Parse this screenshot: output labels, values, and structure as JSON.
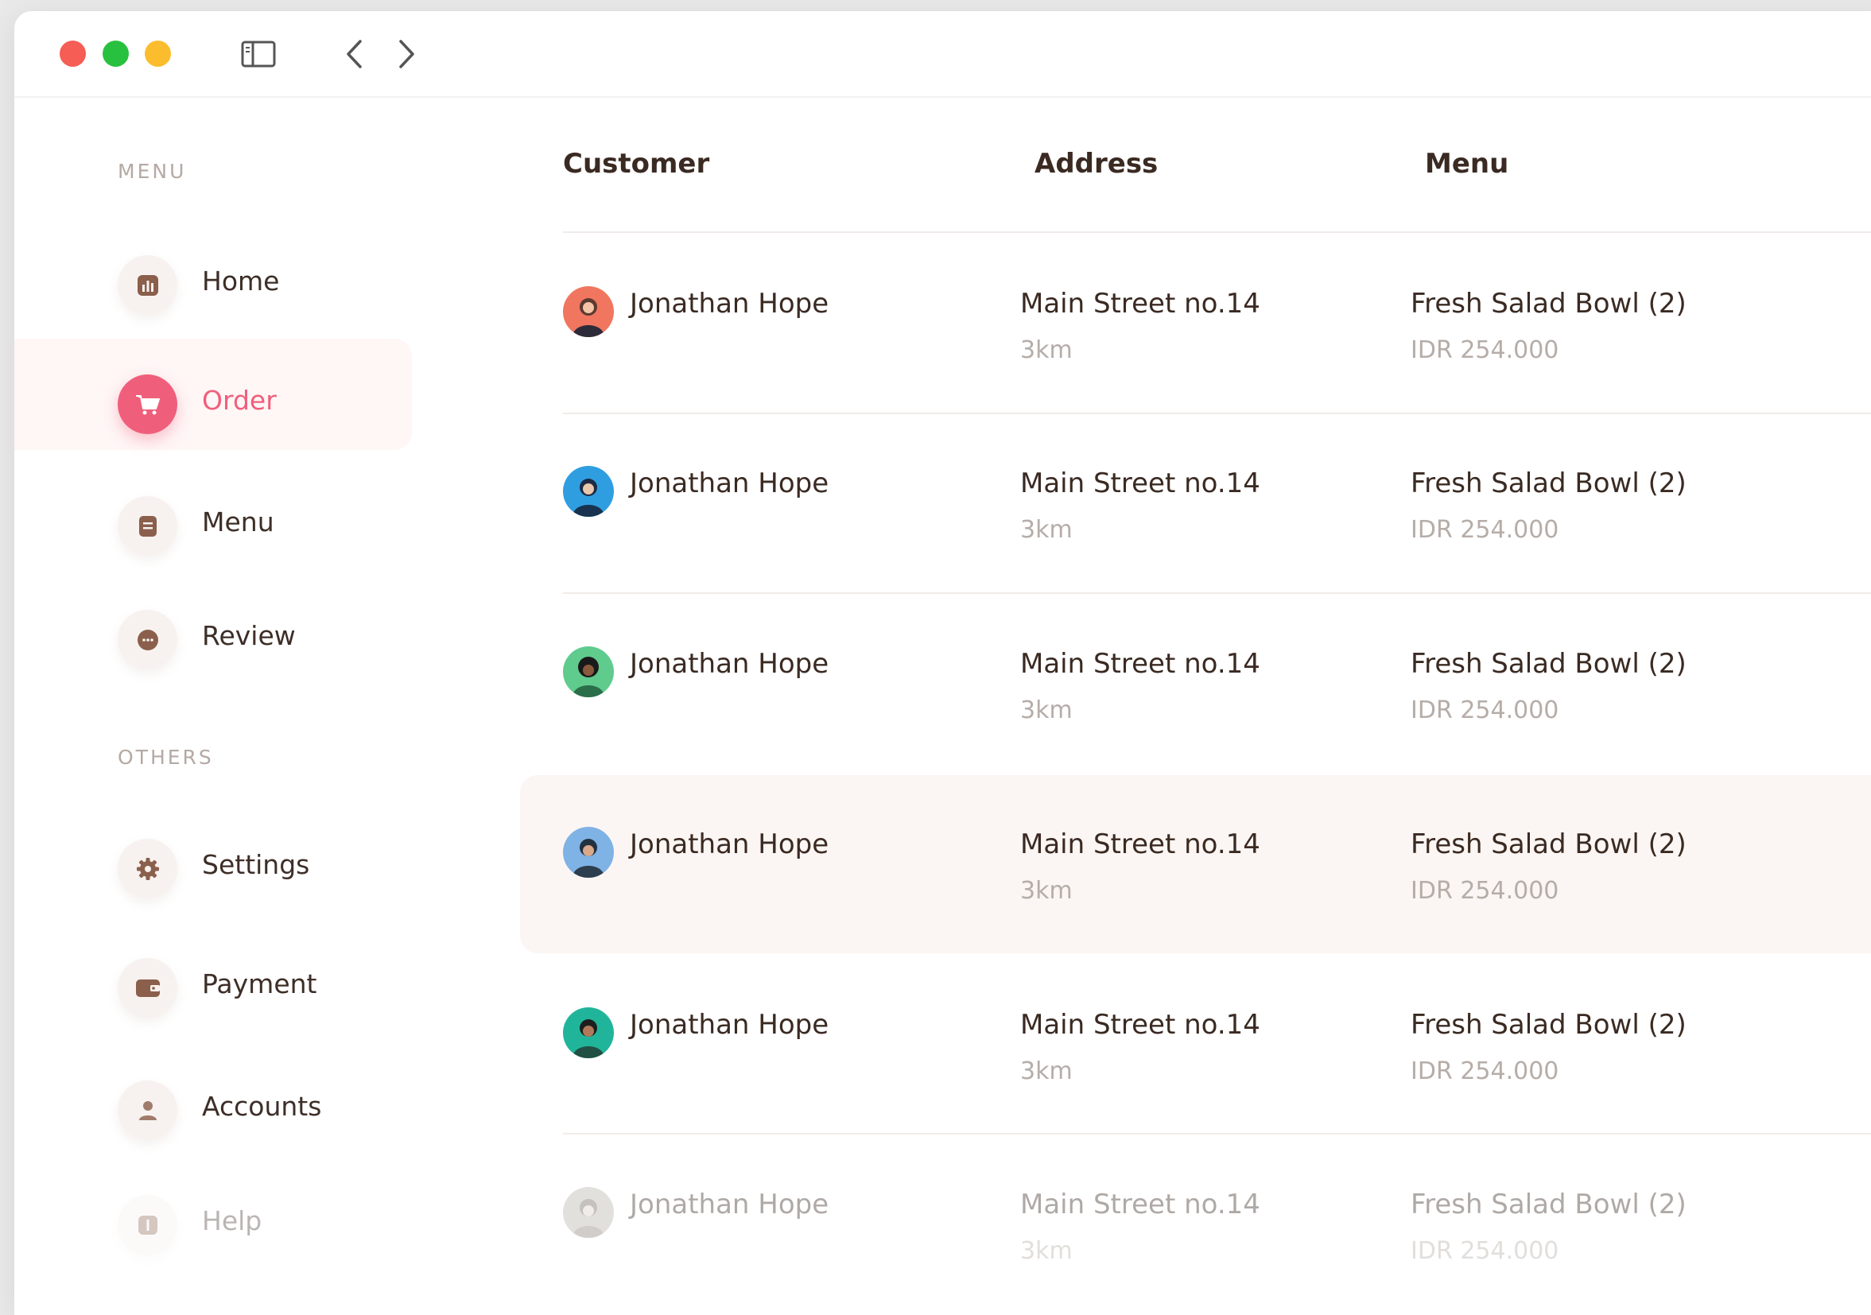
{
  "sidebar": {
    "section_menu": "MENU",
    "section_others": "OTHERS",
    "items": [
      {
        "label": "Home",
        "icon": "chart-icon"
      },
      {
        "label": "Order",
        "icon": "cart-icon"
      },
      {
        "label": "Menu",
        "icon": "document-icon"
      },
      {
        "label": "Review",
        "icon": "chat-icon"
      },
      {
        "label": "Settings",
        "icon": "gear-icon"
      },
      {
        "label": "Payment",
        "icon": "wallet-icon"
      },
      {
        "label": "Accounts",
        "icon": "user-icon"
      },
      {
        "label": "Help",
        "icon": "help-icon"
      }
    ]
  },
  "table": {
    "headers": {
      "customer": "Customer",
      "address": "Address",
      "menu": "Menu"
    },
    "rows": [
      {
        "name": "Jonathan Hope",
        "address": "Main Street no.14",
        "distance": "3km",
        "menu": "Fresh Salad Bowl (2)",
        "price": "IDR 254.000",
        "avatar_color": "#f0765f",
        "status_color": "#fbe0e6"
      },
      {
        "name": "Jonathan Hope",
        "address": "Main Street no.14",
        "distance": "3km",
        "menu": "Fresh Salad Bowl (2)",
        "price": "IDR 254.000",
        "avatar_color": "#2f9ee0",
        "status_color": "#dff3e2"
      },
      {
        "name": "Jonathan Hope",
        "address": "Main Street no.14",
        "distance": "3km",
        "menu": "Fresh Salad Bowl (2)",
        "price": "IDR 254.000",
        "avatar_color": "#5fcb8d",
        "status_color": "#f9dff0"
      },
      {
        "name": "Jonathan Hope",
        "address": "Main Street no.14",
        "distance": "3km",
        "menu": "Fresh Salad Bowl (2)",
        "price": "IDR 254.000",
        "avatar_color": "#7fb2e5",
        "status_color": "#fde3d3"
      },
      {
        "name": "Jonathan Hope",
        "address": "Main Street no.14",
        "distance": "3km",
        "menu": "Fresh Salad Bowl (2)",
        "price": "IDR 254.000",
        "avatar_color": "#20b59a",
        "status_color": "#fde8d8"
      },
      {
        "name": "Jonathan Hope",
        "address": "Main Street no.14",
        "distance": "3km",
        "menu": "Fresh Salad Bowl (2)",
        "price": "IDR 254.000",
        "avatar_color": "#b9b3ab",
        "status_color": "#f7e3ea"
      }
    ]
  }
}
